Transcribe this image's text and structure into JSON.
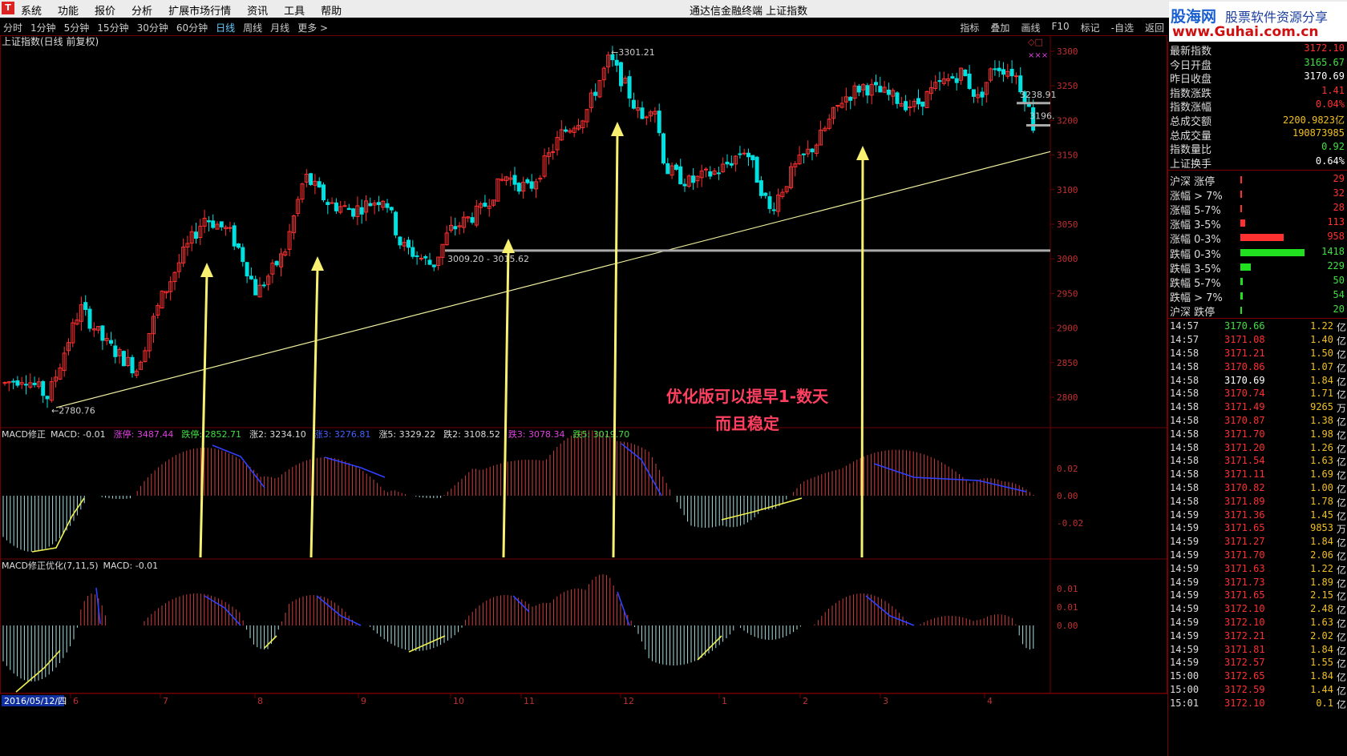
{
  "window": {
    "menus": [
      "系统",
      "功能",
      "报价",
      "分析",
      "扩展市场行情",
      "资讯",
      "工具",
      "帮助"
    ],
    "title": "通达信金融终端  上证指数"
  },
  "toolbar": {
    "periods": [
      "分时",
      "1分钟",
      "5分钟",
      "15分钟",
      "30分钟",
      "60分钟",
      "日线",
      "周线",
      "月线",
      "更多 >"
    ],
    "active_period": "日线",
    "tools": [
      "指标",
      "叠加",
      "画线",
      "F10",
      "标记",
      "-自选",
      "返回"
    ]
  },
  "brand": {
    "name": "股海网",
    "slogan": "股票软件资源分享",
    "url": "www.Guhai.com.cn"
  },
  "main_chart": {
    "title": "上证指数(日线 前复权)",
    "high_label": "3301.21",
    "low_label": "2780.76",
    "range_label": "3009.20 - 3015.62",
    "right_label_1": "3238.91",
    "right_label_2": "3196.",
    "y_ticks": [
      "3300",
      "3250",
      "3200",
      "3150",
      "3100",
      "3050",
      "3000",
      "2950",
      "2900",
      "2850",
      "2800"
    ],
    "annotation_line1": "优化版可以提早1-数天",
    "annotation_line2": "而且稳定"
  },
  "macd1": {
    "name": "MACD修正",
    "macd_label": "MACD: -0.01",
    "items": [
      {
        "text": "涨停: 3487.44",
        "color": "#e040e0"
      },
      {
        "text": "跌停: 2852.71",
        "color": "#40e040"
      },
      {
        "text": "涨2: 3234.10",
        "color": "#dddddd"
      },
      {
        "text": "涨3: 3276.81",
        "color": "#4060ff"
      },
      {
        "text": "涨5: 3329.22",
        "color": "#dddddd"
      },
      {
        "text": "跌2: 3108.52",
        "color": "#dddddd"
      },
      {
        "text": "跌3: 3078.34",
        "color": "#e040e0"
      },
      {
        "text": "跌5: 3019.70",
        "color": "#40e040"
      }
    ],
    "y_ticks": [
      "0.02",
      "0.00",
      "-0.02"
    ]
  },
  "macd2": {
    "name": "MACD修正优化(7,11,5)",
    "macd_label": "MACD: -0.01",
    "y_ticks": [
      "0.01",
      "0.01",
      "0.00"
    ]
  },
  "x_axis": {
    "date_label": "2016/05/12/四",
    "months": [
      "6",
      "7",
      "8",
      "9",
      "10",
      "11",
      "12",
      "1",
      "2",
      "3",
      "4"
    ]
  },
  "stats": [
    {
      "label": "最新指数",
      "value": "3172.10",
      "color": "#ff3030"
    },
    {
      "label": "今日开盘",
      "value": "3165.67",
      "color": "#40e040"
    },
    {
      "label": "昨日收盘",
      "value": "3170.69",
      "color": "#ffffff"
    },
    {
      "label": "指数涨跌",
      "value": "1.41",
      "color": "#ff3030"
    },
    {
      "label": "指数涨幅",
      "value": "0.04%",
      "color": "#ff3030"
    },
    {
      "label": "总成交额",
      "value": "2200.9823亿",
      "color": "#f0c020"
    },
    {
      "label": "总成交量",
      "value": "190873985",
      "color": "#f0c020"
    },
    {
      "label": "指数量比",
      "value": "0.92",
      "color": "#40e040"
    },
    {
      "label": "上证换手",
      "value": "0.64%",
      "color": "#ffffff"
    }
  ],
  "limits": [
    {
      "label": "沪深 涨停",
      "value": "29",
      "color": "#ff3030",
      "fraction": 0.02
    },
    {
      "label": "涨幅 > 7%",
      "value": "32",
      "color": "#ff3030",
      "fraction": 0.02
    },
    {
      "label": "涨幅 5-7%",
      "value": "28",
      "color": "#ff3030",
      "fraction": 0.02
    },
    {
      "label": "涨幅 3-5%",
      "value": "113",
      "color": "#ff3030",
      "fraction": 0.08
    },
    {
      "label": "涨幅 0-3%",
      "value": "958",
      "color": "#ff3030",
      "fraction": 0.67
    },
    {
      "label": "跌幅 0-3%",
      "value": "1418",
      "color": "#20e020",
      "fraction": 1.0
    },
    {
      "label": "跌幅 3-5%",
      "value": "229",
      "color": "#20e020",
      "fraction": 0.16
    },
    {
      "label": "跌幅 5-7%",
      "value": "50",
      "color": "#20e020",
      "fraction": 0.04
    },
    {
      "label": "跌幅 > 7%",
      "value": "54",
      "color": "#20e020",
      "fraction": 0.04
    },
    {
      "label": "沪深 跌停",
      "value": "20",
      "color": "#20e020",
      "fraction": 0.02
    }
  ],
  "ticks": [
    {
      "time": "14:57",
      "price": "3170.66",
      "vol": "1.22",
      "unit": "亿",
      "color": "#40e040"
    },
    {
      "time": "14:57",
      "price": "3171.08",
      "vol": "1.40",
      "unit": "亿",
      "color": "#ff3030"
    },
    {
      "time": "14:58",
      "price": "3171.21",
      "vol": "1.50",
      "unit": "亿",
      "color": "#ff3030"
    },
    {
      "time": "14:58",
      "price": "3170.86",
      "vol": "1.07",
      "unit": "亿",
      "color": "#ff3030"
    },
    {
      "time": "14:58",
      "price": "3170.69",
      "vol": "1.84",
      "unit": "亿",
      "color": "#ffffff"
    },
    {
      "time": "14:58",
      "price": "3170.74",
      "vol": "1.71",
      "unit": "亿",
      "color": "#ff3030"
    },
    {
      "time": "14:58",
      "price": "3171.49",
      "vol": "9265",
      "unit": "万",
      "color": "#ff3030"
    },
    {
      "time": "14:58",
      "price": "3170.87",
      "vol": "1.38",
      "unit": "亿",
      "color": "#ff3030"
    },
    {
      "time": "14:58",
      "price": "3171.70",
      "vol": "1.98",
      "unit": "亿",
      "color": "#ff3030"
    },
    {
      "time": "14:58",
      "price": "3171.20",
      "vol": "1.26",
      "unit": "亿",
      "color": "#ff3030"
    },
    {
      "time": "14:58",
      "price": "3171.54",
      "vol": "1.63",
      "unit": "亿",
      "color": "#ff3030"
    },
    {
      "time": "14:58",
      "price": "3171.11",
      "vol": "1.69",
      "unit": "亿",
      "color": "#ff3030"
    },
    {
      "time": "14:58",
      "price": "3170.82",
      "vol": "1.00",
      "unit": "亿",
      "color": "#ff3030"
    },
    {
      "time": "14:58",
      "price": "3171.89",
      "vol": "1.78",
      "unit": "亿",
      "color": "#ff3030"
    },
    {
      "time": "14:59",
      "price": "3171.36",
      "vol": "1.45",
      "unit": "亿",
      "color": "#ff3030"
    },
    {
      "time": "14:59",
      "price": "3171.65",
      "vol": "9853",
      "unit": "万",
      "color": "#ff3030"
    },
    {
      "time": "14:59",
      "price": "3171.27",
      "vol": "1.84",
      "unit": "亿",
      "color": "#ff3030"
    },
    {
      "time": "14:59",
      "price": "3171.70",
      "vol": "2.06",
      "unit": "亿",
      "color": "#ff3030"
    },
    {
      "time": "14:59",
      "price": "3171.63",
      "vol": "1.22",
      "unit": "亿",
      "color": "#ff3030"
    },
    {
      "time": "14:59",
      "price": "3171.73",
      "vol": "1.89",
      "unit": "亿",
      "color": "#ff3030"
    },
    {
      "time": "14:59",
      "price": "3171.65",
      "vol": "2.15",
      "unit": "亿",
      "color": "#ff3030"
    },
    {
      "time": "14:59",
      "price": "3172.10",
      "vol": "2.48",
      "unit": "亿",
      "color": "#ff3030"
    },
    {
      "time": "14:59",
      "price": "3172.10",
      "vol": "1.63",
      "unit": "亿",
      "color": "#ff3030"
    },
    {
      "time": "14:59",
      "price": "3172.21",
      "vol": "2.02",
      "unit": "亿",
      "color": "#ff3030"
    },
    {
      "time": "14:59",
      "price": "3171.81",
      "vol": "1.84",
      "unit": "亿",
      "color": "#ff3030"
    },
    {
      "time": "14:59",
      "price": "3172.57",
      "vol": "1.55",
      "unit": "亿",
      "color": "#ff3030"
    },
    {
      "time": "15:00",
      "price": "3172.65",
      "vol": "1.84",
      "unit": "亿",
      "color": "#ff3030"
    },
    {
      "time": "15:00",
      "price": "3172.59",
      "vol": "1.44",
      "unit": "亿",
      "color": "#ff3030"
    },
    {
      "time": "15:01",
      "price": "3172.10",
      "vol": "0.1",
      "unit": "亿",
      "color": "#ff3030"
    }
  ],
  "colors": {
    "up": "#ff3030",
    "down": "#00e0e0",
    "grid": "#700000",
    "trendline": "#f0f0a0",
    "arrow": "#f8f070",
    "annotation": "#ff4060"
  }
}
